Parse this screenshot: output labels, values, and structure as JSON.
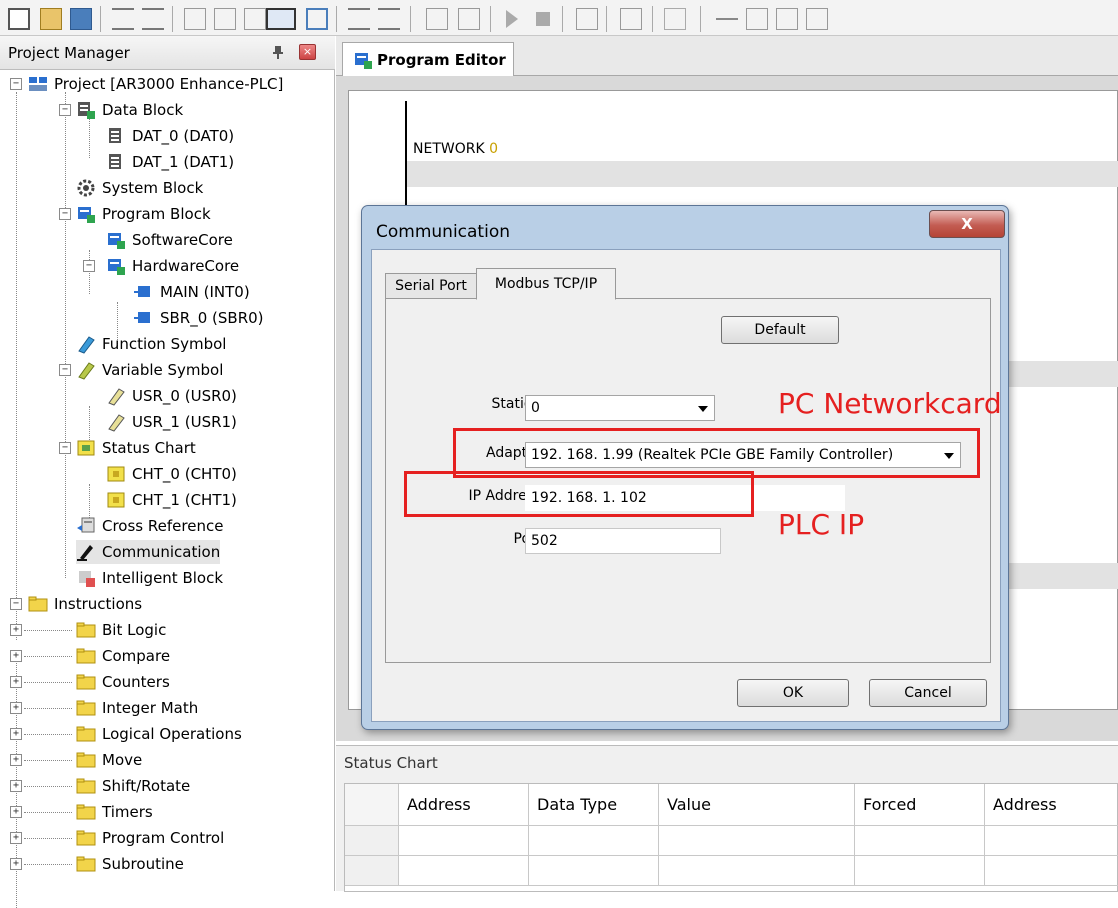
{
  "project_manager": {
    "title": "Project Manager",
    "project": "Project [AR3000 Enhance-PLC]",
    "data_block": "Data Block",
    "dat0": "DAT_0 (DAT0)",
    "dat1": "DAT_1 (DAT1)",
    "system_block": "System Block",
    "program_block": "Program Block",
    "software_core": "SoftwareCore",
    "hardware_core": "HardwareCore",
    "main": "MAIN (INT0)",
    "sbr0": "SBR_0 (SBR0)",
    "function_symbol": "Function Symbol",
    "variable_symbol": "Variable Symbol",
    "usr0": "USR_0 (USR0)",
    "usr1": "USR_1 (USR1)",
    "status_chart": "Status Chart",
    "cht0": "CHT_0 (CHT0)",
    "cht1": "CHT_1 (CHT1)",
    "cross_reference": "Cross Reference",
    "communication": "Communication",
    "intelligent_block": "Intelligent Block",
    "instructions": "Instructions",
    "instruction_folders": [
      "Bit Logic",
      "Compare",
      "Counters",
      "Integer Math",
      "Logical Operations",
      "Move",
      "Shift/Rotate",
      "Timers",
      "Program Control",
      "Subroutine"
    ]
  },
  "editor": {
    "tab_label": "Program Editor",
    "network_label": "NETWORK",
    "network_number": "0"
  },
  "status_chart_panel": {
    "title": "Status Chart",
    "columns": [
      "Address",
      "Data Type",
      "Value",
      "Forced",
      "Address"
    ]
  },
  "dialog": {
    "title": "Communication",
    "close_label": "X",
    "tabs": [
      "Serial Port",
      "Modbus TCP/IP"
    ],
    "default_button": "Default",
    "station_label": "Station:",
    "station_value": "0",
    "adapter_label": "Adapter:",
    "adapter_value": "192. 168. 1.99 (Realtek PCIe GBE Family Controller)",
    "ip_label": "IP Address:",
    "ip_value": "192. 168. 1. 102",
    "port_label": "Port:",
    "port_value": "502",
    "ok_button": "OK",
    "cancel_button": "Cancel"
  },
  "annotations": {
    "pc_networkcard": "PC Networkcard",
    "plc_ip": "PLC IP"
  },
  "colors": {
    "annotation_red": "#e52020",
    "dialog_frame": "#b9cfe6",
    "folder_yellow": "#f2d44a"
  }
}
